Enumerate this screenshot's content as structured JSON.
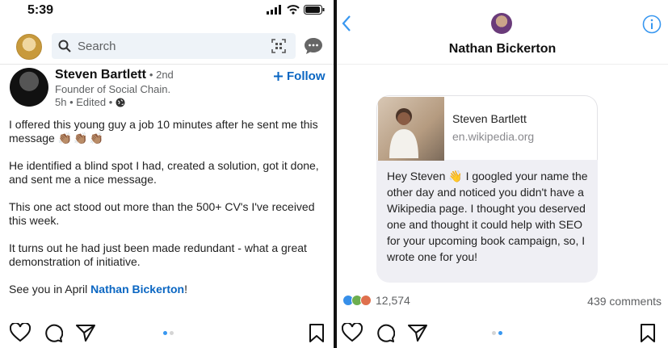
{
  "status_bar": {
    "time": "5:39"
  },
  "linkedin": {
    "search_placeholder": "Search",
    "post": {
      "author": "Steven Bartlett",
      "degree": "• 2nd",
      "headline": "Founder of Social Chain.",
      "meta": "5h • Edited •",
      "follow_label": "Follow",
      "paragraphs": {
        "p1_text": "I offered this young guy a job 10 minutes after he sent me this message",
        "p1_emoji": "👏🏽👏🏽👏🏽",
        "p2": "He identified a blind spot I had, created a solution, got it done, and sent me a nice message.",
        "p3": "This one act stood out more than the 500+ CV's I've received this week.",
        "p4": "It turns out he had just been made redundant - what a great demonstration of initiative.",
        "p5_prefix": "See you in April ",
        "p5_mention": "Nathan Bickerton",
        "p5_suffix": "!"
      }
    }
  },
  "instagram": {
    "contact_name": "Nathan Bickerton",
    "link_card": {
      "title": "Steven Bartlett",
      "domain": "en.wikipedia.org"
    },
    "message": "Hey Steven 👋 I googled your name the other day and noticed you didn't have a Wikipedia page. I thought you deserved one and thought it could help with SEO for your upcoming book campaign, so, I wrote one for you!"
  },
  "engagement": {
    "reactions_count": "12,574",
    "comments": "439 comments"
  },
  "colors": {
    "linkedin_blue": "#0a66c2",
    "ig_blue": "#3897f0",
    "divider": "#111111"
  }
}
